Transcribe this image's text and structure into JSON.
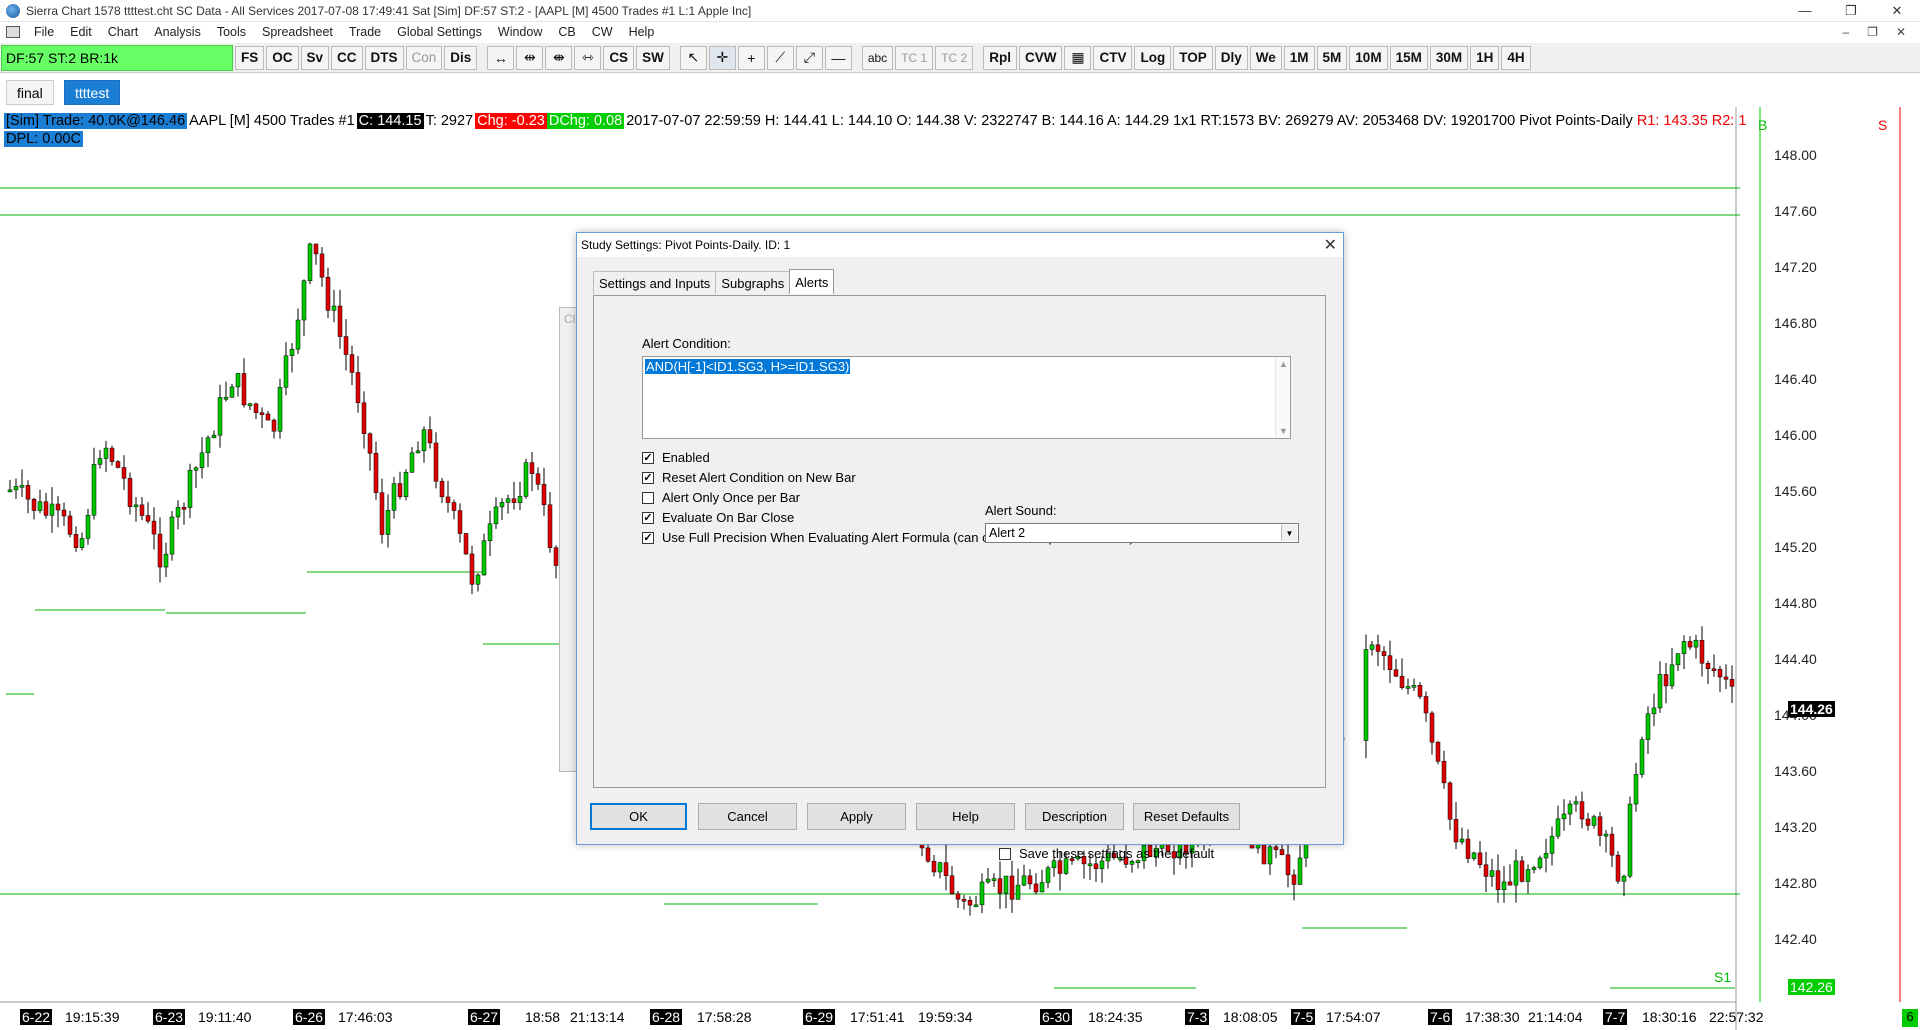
{
  "window": {
    "title": "Sierra Chart 1578 ttttest.cht  SC Data - All Services 2017-07-08  17:49:41 Sat [Sim]  DF:57  ST:2 - [AAPL [M]  4500 Trades  #1  L:1  Apple Inc]",
    "minimize": "—",
    "restore": "❐",
    "close": "✕"
  },
  "menu": {
    "items": [
      "File",
      "Edit",
      "Chart",
      "Analysis",
      "Tools",
      "Spreadsheet",
      "Trade",
      "Global Settings",
      "Window",
      "CB",
      "CW",
      "Help"
    ],
    "mdi_minimize": "–",
    "mdi_restore": "❐",
    "mdi_close": "✕"
  },
  "toolbar": {
    "status": "DF:57  ST:2  BR:1k",
    "group1": [
      "FS",
      "OC",
      "Sv",
      "CC",
      "DTS",
      "Con",
      "Dis"
    ],
    "group1_disabled": [
      "Con"
    ],
    "group2": [
      "CS",
      "SW"
    ],
    "text_tools": [
      "abc",
      "TC 1",
      "TC 2"
    ],
    "group3": [
      "Rpl",
      "CVW"
    ],
    "group4": [
      "CTV",
      "Log",
      "TOP",
      "Dly",
      "We",
      "1M",
      "5M",
      "10M",
      "15M",
      "30M",
      "1H",
      "4H"
    ]
  },
  "chartbook_tabs": [
    "final",
    "ttttest"
  ],
  "chart": {
    "info": {
      "sim_trade": "[Sim]  Trade: 40.0K@146.46",
      "symbol": "AAPL [M]  4500 Trades  #1",
      "close": "C: 144.15",
      "ticks": "T: 2927",
      "change": "Chg: -0.23",
      "dchange": "DChg: 0.08",
      "details": "2017-07-07 22:59:59  H: 144.41  L: 144.10  O: 144.38  V: 2322747  B: 144.16  A: 144.29  1x1 RT:1573  BV: 269279  AV: 2053468  DV: 19201700",
      "study": "Pivot Points-Daily",
      "r1": "R1: 143.35",
      "r2": "R2: 1",
      "dpl": "DPL: 0.00C"
    },
    "buy_label": "B",
    "sell_label": "S",
    "s1_label": "S1",
    "price_labels": [
      "148.00",
      "147.60",
      "147.20",
      "146.80",
      "146.40",
      "146.00",
      "145.60",
      "145.20",
      "144.80",
      "144.40",
      "144.00",
      "143.60",
      "143.20",
      "142.80",
      "142.40"
    ],
    "last_price": "144.26",
    "s1_price": "142.26",
    "date_labels": [
      {
        "text": "6-22",
        "boxed": true
      },
      {
        "text": "19:15:39",
        "boxed": false
      },
      {
        "text": "6-23",
        "boxed": true
      },
      {
        "text": "19:11:40",
        "boxed": false
      },
      {
        "text": "6-26",
        "boxed": true
      },
      {
        "text": "17:46:03",
        "boxed": false
      },
      {
        "text": "6-27",
        "boxed": true
      },
      {
        "text": "18:58",
        "boxed": false
      },
      {
        "text": "21:13:14",
        "boxed": false
      },
      {
        "text": "6-28",
        "boxed": true
      },
      {
        "text": "17:58:28",
        "boxed": false
      },
      {
        "text": "6-29",
        "boxed": true
      },
      {
        "text": "17:51:41",
        "boxed": false
      },
      {
        "text": "19:59:34",
        "boxed": false
      },
      {
        "text": "6-30",
        "boxed": true
      },
      {
        "text": "18:24:35",
        "boxed": false
      },
      {
        "text": "7-3",
        "boxed": true
      },
      {
        "text": "18:08:05",
        "boxed": false
      },
      {
        "text": "7-5",
        "boxed": true
      },
      {
        "text": "17:54:07",
        "boxed": false
      },
      {
        "text": "7-6",
        "boxed": true
      },
      {
        "text": "17:38:30",
        "boxed": false
      },
      {
        "text": "21:14:04",
        "boxed": false
      },
      {
        "text": "7-7",
        "boxed": true
      },
      {
        "text": "18:30:16",
        "boxed": false
      },
      {
        "text": "22:57:32",
        "boxed": false
      }
    ],
    "corner_marker": "6",
    "colors": {
      "up": "#00c800",
      "down": "#e00000",
      "pivot": "#00b000",
      "text_red": "#e00000"
    }
  },
  "ghost_dialog": {
    "title": "Cl",
    "close": "✕"
  },
  "dialog": {
    "title": "Study Settings: Pivot Points-Daily. ID: 1",
    "close": "✕",
    "tabs": [
      "Settings and Inputs",
      "Subgraphs",
      "Alerts"
    ],
    "active_tab": "Alerts",
    "alert_condition_label": "Alert Condition:",
    "alert_formula": "AND(H[-1]<ID1.SG3, H>=ID1.SG3)",
    "checkboxes": [
      {
        "label": "Enabled",
        "checked": true
      },
      {
        "label": "Reset Alert Condition on New Bar",
        "checked": true
      },
      {
        "label": "Alert Only Once per Bar",
        "checked": false
      },
      {
        "label": "Evaluate On Bar Close",
        "checked": true
      },
      {
        "label": "Use Full Precision When Evaluating Alert Formula (can cause unexpected results)",
        "checked": true
      }
    ],
    "alert_sound_label": "Alert Sound:",
    "alert_sound_value": "Alert 2",
    "buttons": [
      "OK",
      "Cancel",
      "Apply",
      "Help",
      "Description",
      "Reset Defaults"
    ],
    "save_default_label": "Save these settings as the default",
    "save_default_checked": false
  }
}
